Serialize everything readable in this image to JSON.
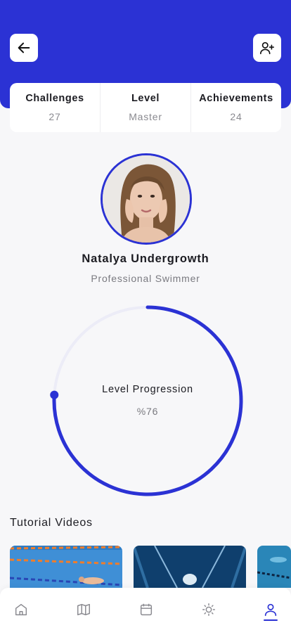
{
  "header": {
    "back_icon": "arrow-left-icon",
    "add_friend_icon": "user-plus-icon",
    "accent_color": "#2b32d4"
  },
  "stats": [
    {
      "label": "Challenges",
      "value": "27"
    },
    {
      "label": "Level",
      "value": "Master"
    },
    {
      "label": "Achievements",
      "value": "24"
    }
  ],
  "profile": {
    "name": "Natalya Undergrowth",
    "role": "Professional Swimmer"
  },
  "progress": {
    "label": "Level Progression",
    "value_text": "%76",
    "percent": 76
  },
  "tutorials": {
    "title": "Tutorial Videos"
  },
  "nav": {
    "items": [
      "home-icon",
      "map-icon",
      "calendar-icon",
      "sun-icon",
      "profile-icon"
    ],
    "active": "profile-icon"
  }
}
